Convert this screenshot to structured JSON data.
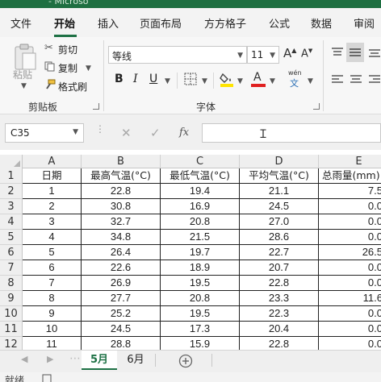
{
  "window": {
    "title_fragment": "- Microso"
  },
  "menu": {
    "items": [
      "文件",
      "开始",
      "插入",
      "页面布局",
      "方方格子",
      "公式",
      "数据",
      "审阅"
    ],
    "active_index": 1
  },
  "clipboard": {
    "paste_label": "粘贴",
    "cut_label": "剪切",
    "copy_label": "复制",
    "format_painter_label": "格式刷",
    "group_label": "剪贴板"
  },
  "font": {
    "name": "等线",
    "size": "11",
    "group_label": "字体",
    "bold": "B",
    "italic": "I",
    "underline": "U",
    "grow": "A",
    "shrink": "A",
    "pinyin_top": "wén",
    "pinyin_bottom": "文",
    "fill_color": "#ffe400",
    "text_color": "#e02020"
  },
  "formula_bar": {
    "name_box": "C35",
    "fx_label": "fx",
    "content": ""
  },
  "columns": [
    "A",
    "B",
    "C",
    "D",
    "E"
  ],
  "rows": [
    {
      "n": "1",
      "cells": [
        "日期",
        "最高气温(°C)",
        "最低气温(°C)",
        "平均气温(°C)",
        "总雨量(mm)"
      ]
    },
    {
      "n": "2",
      "cells": [
        "1",
        "22.8",
        "19.4",
        "21.1",
        "7.5"
      ]
    },
    {
      "n": "3",
      "cells": [
        "2",
        "30.8",
        "16.9",
        "24.5",
        "0.0"
      ]
    },
    {
      "n": "4",
      "cells": [
        "3",
        "32.7",
        "20.8",
        "27.0",
        "0.0"
      ]
    },
    {
      "n": "5",
      "cells": [
        "4",
        "34.8",
        "21.5",
        "28.6",
        "0.0"
      ]
    },
    {
      "n": "6",
      "cells": [
        "5",
        "26.4",
        "19.7",
        "22.7",
        "26.5"
      ]
    },
    {
      "n": "7",
      "cells": [
        "6",
        "22.6",
        "18.9",
        "20.7",
        "0.0"
      ]
    },
    {
      "n": "8",
      "cells": [
        "7",
        "26.9",
        "19.5",
        "22.8",
        "0.0"
      ]
    },
    {
      "n": "9",
      "cells": [
        "8",
        "27.7",
        "20.8",
        "23.3",
        "11.6"
      ]
    },
    {
      "n": "10",
      "cells": [
        "9",
        "25.2",
        "19.5",
        "22.3",
        "0.0"
      ]
    },
    {
      "n": "11",
      "cells": [
        "10",
        "24.5",
        "17.3",
        "20.4",
        "0.0"
      ]
    },
    {
      "n": "12",
      "cells": [
        "11",
        "28.8",
        "15.9",
        "22.8",
        "0.0"
      ]
    }
  ],
  "sheets": {
    "tabs": [
      "5月",
      "6月"
    ],
    "active_index": 0
  },
  "status": {
    "text": "就绪"
  }
}
